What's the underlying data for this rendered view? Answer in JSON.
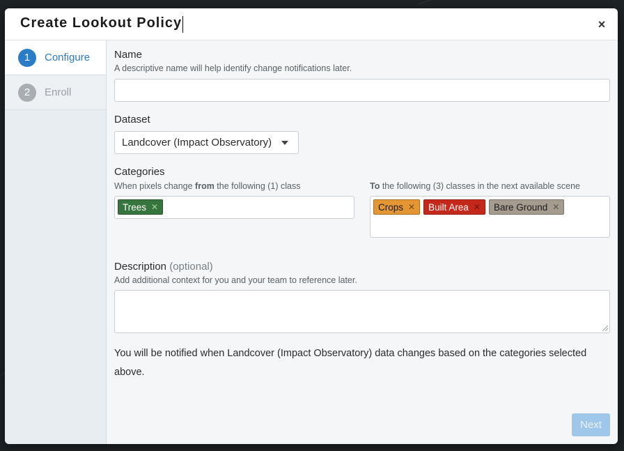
{
  "modal": {
    "title": "Create Lookout Policy",
    "close_icon": "×"
  },
  "steps": [
    {
      "number": "1",
      "label": "Configure",
      "active": true
    },
    {
      "number": "2",
      "label": "Enroll",
      "active": false
    }
  ],
  "form": {
    "name": {
      "label": "Name",
      "hint": "A descriptive name will help identify change notifications later.",
      "value": ""
    },
    "dataset": {
      "label": "Dataset",
      "selected": "Landcover (Impact Observatory)"
    },
    "categories": {
      "label": "Categories",
      "from_hint_pre": "When pixels change ",
      "from_hint_bold": "from",
      "from_hint_post": " the following (1) class",
      "to_hint_bold": "To",
      "to_hint_post": " the following (3) classes in the next available scene",
      "from_tags": [
        {
          "label": "Trees",
          "color": "#37753f"
        }
      ],
      "to_tags": [
        {
          "label": "Crops",
          "color": "#e49635"
        },
        {
          "label": "Built Area",
          "color": "#c4281b"
        },
        {
          "label": "Bare Ground",
          "color": "#a59b8f"
        }
      ],
      "remove_icon": "✕"
    },
    "description": {
      "label": "Description",
      "optional": "(optional)",
      "hint": "Add additional context for you and your team to reference later.",
      "value": ""
    },
    "notice": "You will be notified when Landcover (Impact Observatory) data changes based on the categories selected above.",
    "next_label": "Next"
  },
  "colors": {
    "accent": "#2a7cc7",
    "next_disabled": "#9fc7ea"
  }
}
